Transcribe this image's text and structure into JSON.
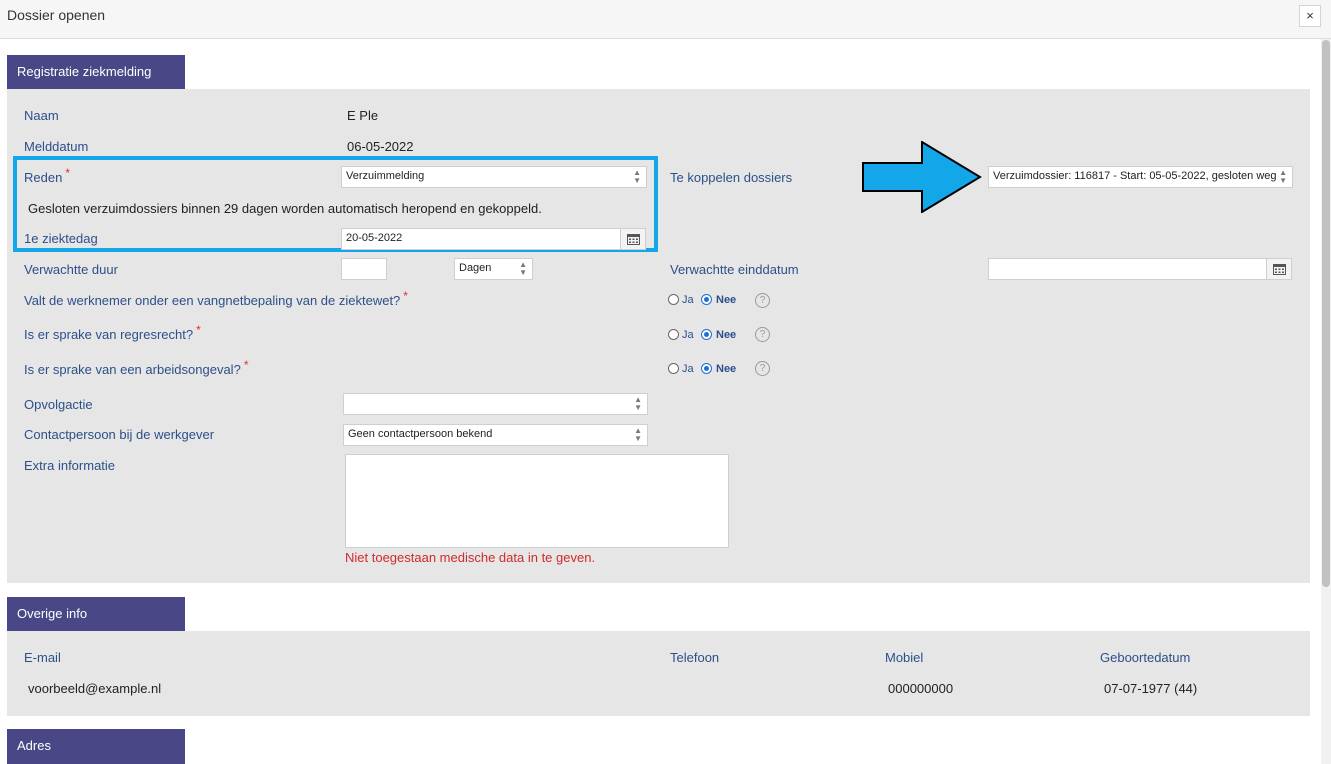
{
  "dialog": {
    "title": "Dossier openen",
    "close_label": "×"
  },
  "registratie": {
    "header": "Registratie ziekmelding",
    "naam_label": "Naam",
    "naam_value": "E Ple",
    "melddatum_label": "Melddatum",
    "melddatum_value": "06-05-2022",
    "reden_label": "Reden",
    "reden_value": "Verzuimmelding",
    "info_text": "Gesloten verzuimdossiers binnen 29 dagen worden automatisch heropend en gekoppeld.",
    "ziektedag_label": "1e ziektedag",
    "ziektedag_value": "20-05-2022",
    "koppelen_label": "Te koppelen dossiers",
    "koppelen_value": "Verzuimdossier: 116817 - Start: 05-05-2022, gesloten weg",
    "duur_label": "Verwachtte duur",
    "duur_value": "",
    "duur_unit": "Dagen",
    "einddatum_label": "Verwachtte einddatum",
    "einddatum_value": "",
    "vangnet_label": "Valt de werknemer onder een vangnetbepaling van de ziektewet?",
    "regres_label": "Is er sprake van regresrecht?",
    "arbeidsongeval_label": "Is er sprake van een arbeidsongeval?",
    "ja_label": "Ja",
    "nee_label": "Nee",
    "help_glyph": "?",
    "required_mark": "*",
    "opvolgactie_label": "Opvolgactie",
    "opvolgactie_value": "",
    "contactpersoon_label": "Contactpersoon bij de werkgever",
    "contactpersoon_value": "Geen contactpersoon bekend",
    "extra_label": "Extra informatie",
    "extra_value": "",
    "warning": "Niet toegestaan medische data in te geven."
  },
  "overige": {
    "header": "Overige info",
    "email_label": "E-mail",
    "email_value": "voorbeeld@example.nl",
    "telefoon_label": "Telefoon",
    "telefoon_value": "",
    "mobiel_label": "Mobiel",
    "mobiel_value": "000000000",
    "geboortedatum_label": "Geboortedatum",
    "geboortedatum_value": "07-07-1977 (44)"
  },
  "adres": {
    "header": "Adres"
  },
  "colors": {
    "section_header": "#4a4787",
    "label": "#2d4f8a",
    "highlight": "#13a6e8",
    "arrow": "#13a6e8",
    "required": "#e03030"
  }
}
